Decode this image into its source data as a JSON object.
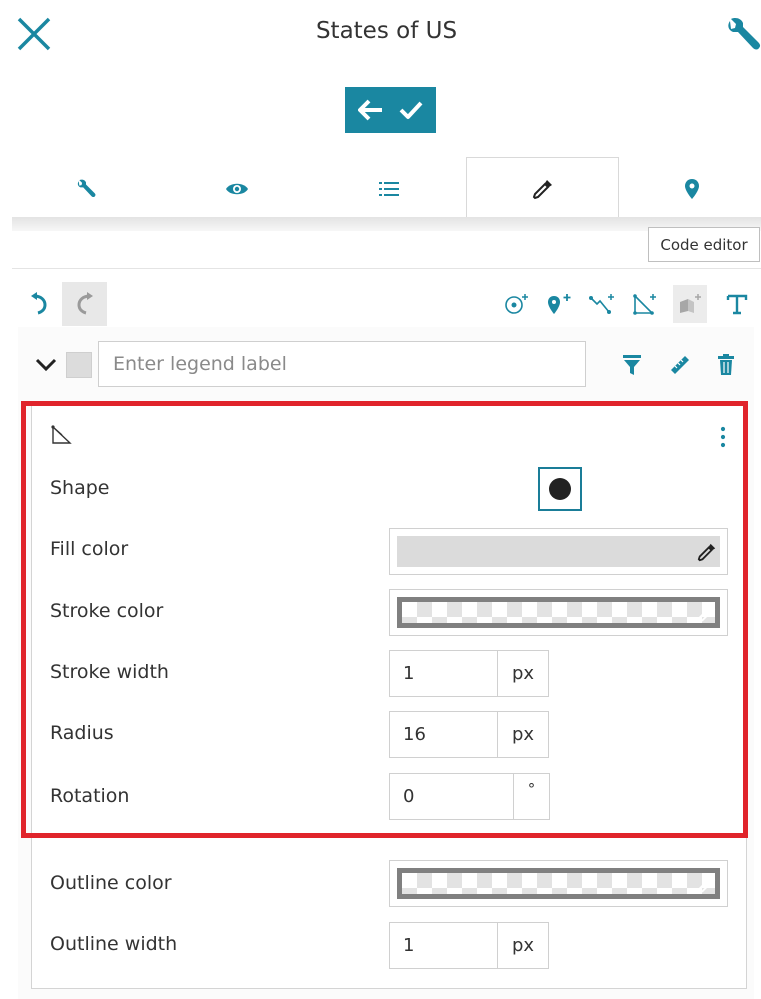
{
  "header": {
    "title": "States of US"
  },
  "tabs": [
    {
      "name": "settings",
      "icon": "wrench-icon"
    },
    {
      "name": "visibility",
      "icon": "eye-icon"
    },
    {
      "name": "list",
      "icon": "list-icon"
    },
    {
      "name": "style",
      "icon": "eyedropper-icon",
      "active": true
    },
    {
      "name": "location",
      "icon": "map-marker-icon"
    }
  ],
  "tooltip": {
    "code_editor": "Code editor"
  },
  "legend": {
    "placeholder": "Enter legend label",
    "label_value": ""
  },
  "symbol": {
    "shape_label": "Shape",
    "fill_color_label": "Fill color",
    "stroke_color_label": "Stroke color",
    "stroke_width_label": "Stroke width",
    "stroke_width_value": "1",
    "stroke_width_unit": "px",
    "radius_label": "Radius",
    "radius_value": "16",
    "radius_unit": "px",
    "rotation_label": "Rotation",
    "rotation_value": "0",
    "rotation_unit": "°",
    "fill_color": "#dbdbdb",
    "stroke_color": "#808080"
  },
  "outline": {
    "color_label": "Outline color",
    "width_label": "Outline width",
    "width_value": "1",
    "width_unit": "px"
  },
  "colors": {
    "accent": "#1a87a1",
    "highlight": "#e0242b"
  }
}
